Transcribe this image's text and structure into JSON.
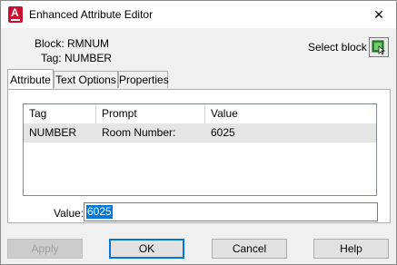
{
  "window": {
    "title": "Enhanced Attribute Editor",
    "close_glyph": "✕"
  },
  "header": {
    "block_label": "Block: RMNUM",
    "tag_label": "Tag: NUMBER",
    "select_block_label": "Select block"
  },
  "tabs": [
    {
      "label": "Attribute"
    },
    {
      "label": "Text Options"
    },
    {
      "label": "Properties"
    }
  ],
  "table": {
    "columns": [
      "Tag",
      "Prompt",
      "Value"
    ],
    "rows": [
      {
        "tag": "NUMBER",
        "prompt": "Room Number:",
        "value": "6025"
      }
    ]
  },
  "value_field": {
    "label": "Value:",
    "value": "6025"
  },
  "buttons": {
    "apply": "Apply",
    "ok": "OK",
    "cancel": "Cancel",
    "help": "Help"
  },
  "colors": {
    "accent": "#0078d7",
    "app_icon": "#c8102e",
    "selected_row": "#e5e5e5"
  }
}
